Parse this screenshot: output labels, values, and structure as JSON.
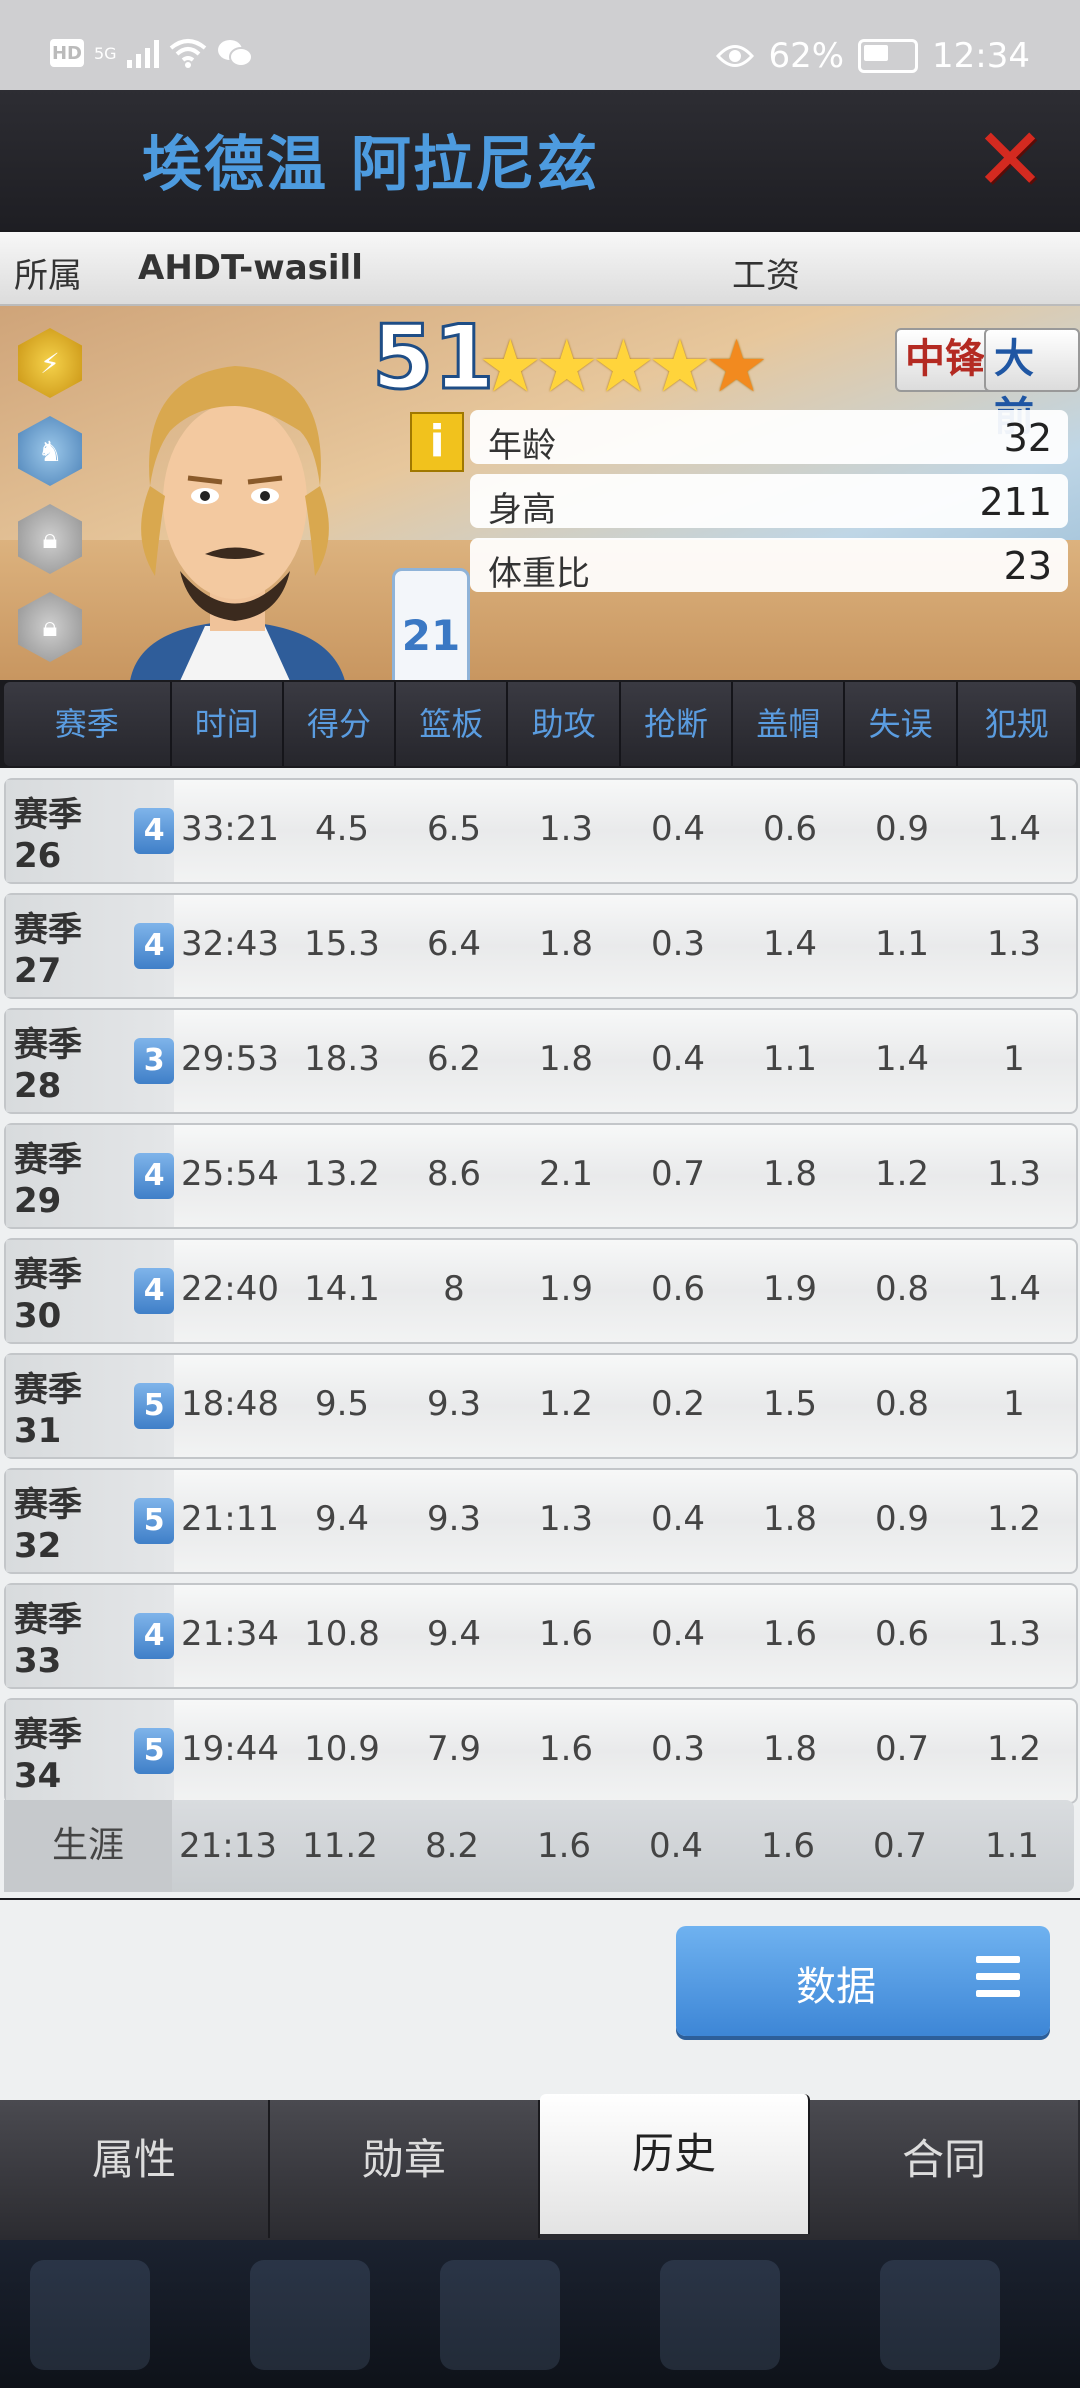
{
  "status_bar": {
    "left_icons": [
      "HD",
      "5G",
      "signal-bars",
      "wifi-icon",
      "wechat-icon"
    ],
    "battery": "62%",
    "time": "12:34"
  },
  "header": {
    "player_name": "埃德温 阿拉尼兹",
    "close_label": "✕"
  },
  "info_strip": {
    "team_label": "所属",
    "team_value": "AHDT-wasill",
    "salary_label": "工资"
  },
  "player": {
    "rating": "51",
    "stars": 4.5,
    "positions": [
      "中锋",
      "大前"
    ],
    "jersey_number": "21",
    "attributes": [
      {
        "label": "年龄",
        "value": "32"
      },
      {
        "label": "身高",
        "value": "211"
      },
      {
        "label": "体重比",
        "value": "23"
      }
    ],
    "info_icon": "i"
  },
  "table": {
    "columns": [
      "赛季",
      "时间",
      "得分",
      "篮板",
      "助攻",
      "抢断",
      "盖帽",
      "失误",
      "犯规"
    ],
    "rows": [
      {
        "season": "赛季26",
        "level": "4",
        "values": [
          "33:21",
          "4.5",
          "6.5",
          "1.3",
          "0.4",
          "0.6",
          "0.9",
          "1.4"
        ]
      },
      {
        "season": "赛季27",
        "level": "4",
        "values": [
          "32:43",
          "15.3",
          "6.4",
          "1.8",
          "0.3",
          "1.4",
          "1.1",
          "1.3"
        ]
      },
      {
        "season": "赛季28",
        "level": "3",
        "values": [
          "29:53",
          "18.3",
          "6.2",
          "1.8",
          "0.4",
          "1.1",
          "1.4",
          "1"
        ]
      },
      {
        "season": "赛季29",
        "level": "4",
        "values": [
          "25:54",
          "13.2",
          "8.6",
          "2.1",
          "0.7",
          "1.8",
          "1.2",
          "1.3"
        ]
      },
      {
        "season": "赛季30",
        "level": "4",
        "values": [
          "22:40",
          "14.1",
          "8",
          "1.9",
          "0.6",
          "1.9",
          "0.8",
          "1.4"
        ]
      },
      {
        "season": "赛季31",
        "level": "5",
        "values": [
          "18:48",
          "9.5",
          "9.3",
          "1.2",
          "0.2",
          "1.5",
          "0.8",
          "1"
        ]
      },
      {
        "season": "赛季32",
        "level": "5",
        "values": [
          "21:11",
          "9.4",
          "9.3",
          "1.3",
          "0.4",
          "1.8",
          "0.9",
          "1.2"
        ]
      },
      {
        "season": "赛季33",
        "level": "4",
        "values": [
          "21:34",
          "10.8",
          "9.4",
          "1.6",
          "0.4",
          "1.6",
          "0.6",
          "1.3"
        ]
      },
      {
        "season": "赛季34",
        "level": "5",
        "values": [
          "19:44",
          "10.9",
          "7.9",
          "1.6",
          "0.3",
          "1.8",
          "0.7",
          "1.2"
        ]
      }
    ],
    "career": {
      "label": "生涯",
      "values": [
        "21:13",
        "11.2",
        "8.2",
        "1.6",
        "0.4",
        "1.6",
        "0.7",
        "1.1"
      ]
    }
  },
  "data_button": {
    "label": "数据"
  },
  "tabs": [
    {
      "label": "属性",
      "active": false
    },
    {
      "label": "勋章",
      "active": false
    },
    {
      "label": "历史",
      "active": true
    },
    {
      "label": "合同",
      "active": false
    }
  ],
  "colors": {
    "name_blue": "#4d9bdf",
    "close_red": "#d42a20",
    "header_text_blue": "#5a9ce0",
    "level_badge_blue": "#3f7fc8",
    "center_red": "#b42a22",
    "forward_blue": "#1f56a3"
  }
}
